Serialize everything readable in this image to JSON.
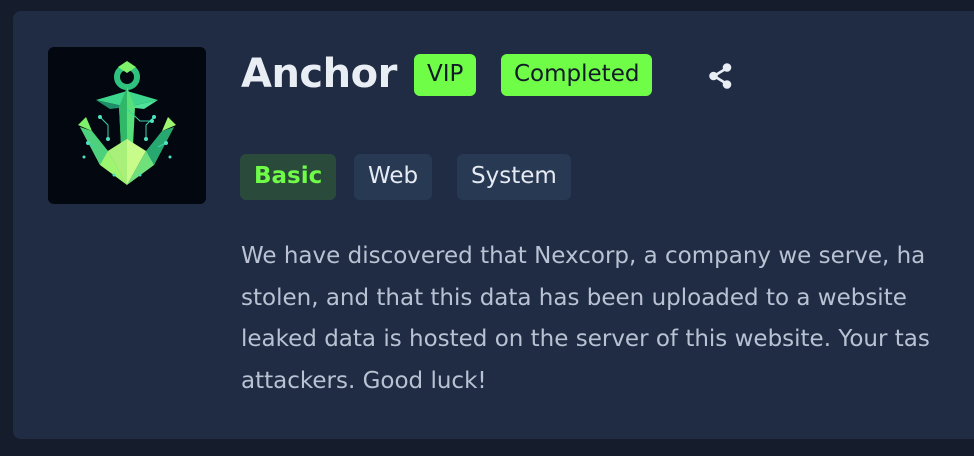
{
  "room": {
    "title": "Anchor",
    "badges": {
      "vip": "VIP",
      "completed": "Completed"
    },
    "tags": [
      {
        "label": "Basic"
      },
      {
        "label": "Web"
      },
      {
        "label": "System"
      }
    ],
    "description_lines": [
      "We have discovered that Nexcorp, a company we serve, ha",
      "stolen, and that this data has been uploaded to a website",
      "leaked data is hosted on the server of this website. Your tas",
      "attackers. Good luck!"
    ]
  },
  "icons": {
    "logo": "anchor-logo-icon",
    "share": "share-icon"
  },
  "colors": {
    "background": "#151d2d",
    "card": "#1f2c44",
    "accent_green": "#6ffd48",
    "basic_tag_bg": "#2a4a3c",
    "tag_bg": "#283954"
  }
}
